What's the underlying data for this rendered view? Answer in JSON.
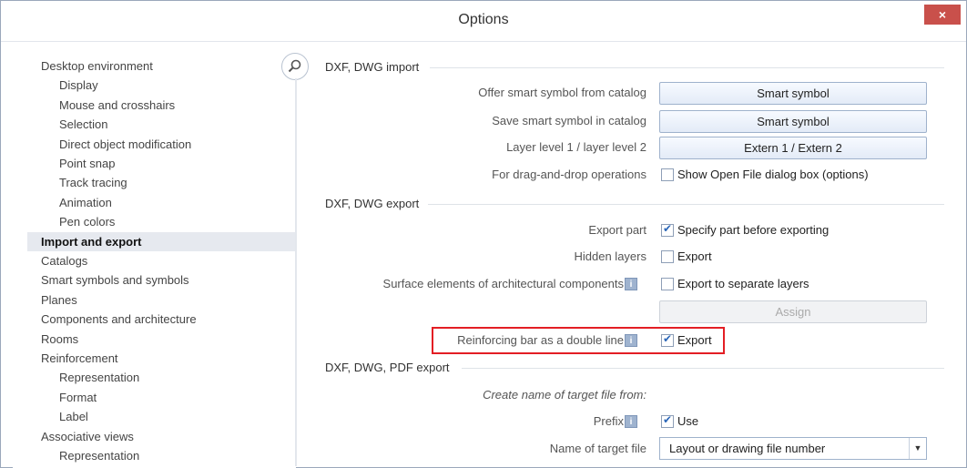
{
  "window": {
    "title": "Options",
    "close_label": "×"
  },
  "sidebar": {
    "items": [
      {
        "label": "Desktop environment",
        "level": "top"
      },
      {
        "label": "Display",
        "level": "sub"
      },
      {
        "label": "Mouse and crosshairs",
        "level": "sub"
      },
      {
        "label": "Selection",
        "level": "sub"
      },
      {
        "label": "Direct object modification",
        "level": "sub"
      },
      {
        "label": "Point snap",
        "level": "sub"
      },
      {
        "label": "Track tracing",
        "level": "sub"
      },
      {
        "label": "Animation",
        "level": "sub"
      },
      {
        "label": "Pen colors",
        "level": "sub"
      },
      {
        "label": "Import and export",
        "level": "top",
        "selected": true
      },
      {
        "label": "Catalogs",
        "level": "top"
      },
      {
        "label": "Smart symbols and symbols",
        "level": "top"
      },
      {
        "label": "Planes",
        "level": "top"
      },
      {
        "label": "Components and architecture",
        "level": "top"
      },
      {
        "label": "Rooms",
        "level": "top"
      },
      {
        "label": "Reinforcement",
        "level": "top"
      },
      {
        "label": "Representation",
        "level": "sub"
      },
      {
        "label": "Format",
        "level": "sub"
      },
      {
        "label": "Label",
        "level": "sub"
      },
      {
        "label": "Associative views",
        "level": "top"
      },
      {
        "label": "Representation",
        "level": "sub"
      }
    ]
  },
  "sections": {
    "dxf_import": {
      "title": "DXF, DWG import",
      "offer_smart_symbol_label": "Offer smart symbol from catalog",
      "offer_smart_symbol_button": "Smart symbol",
      "save_smart_symbol_label": "Save smart symbol in catalog",
      "save_smart_symbol_button": "Smart symbol",
      "layer_level_label": "Layer level 1 / layer level 2",
      "layer_level_button": "Extern 1 / Extern 2",
      "drag_drop_label": "For drag-and-drop operations",
      "drag_drop_checkbox_label": "Show Open File dialog box (options)",
      "drag_drop_checked": false
    },
    "dxf_export": {
      "title": "DXF, DWG export",
      "export_part_label": "Export part",
      "export_part_checkbox_label": "Specify part before exporting",
      "export_part_checked": true,
      "hidden_layers_label": "Hidden layers",
      "hidden_layers_checkbox_label": "Export",
      "hidden_layers_checked": false,
      "surface_elements_label": "Surface elements of architectural components",
      "surface_elements_checkbox_label": "Export to separate layers",
      "surface_elements_checked": false,
      "assign_button": "Assign",
      "reinforcing_bar_label": "Reinforcing bar as a double line",
      "reinforcing_bar_checkbox_label": "Export",
      "reinforcing_bar_checked": true
    },
    "pdf_export": {
      "title": "DXF, DWG, PDF export",
      "create_name_label": "Create name of target file from:",
      "prefix_label": "Prefix",
      "prefix_checkbox_label": "Use",
      "prefix_checked": true,
      "target_file_label": "Name of target file",
      "target_file_value": "Layout or drawing file number"
    }
  },
  "info_icon_glyph": "i"
}
